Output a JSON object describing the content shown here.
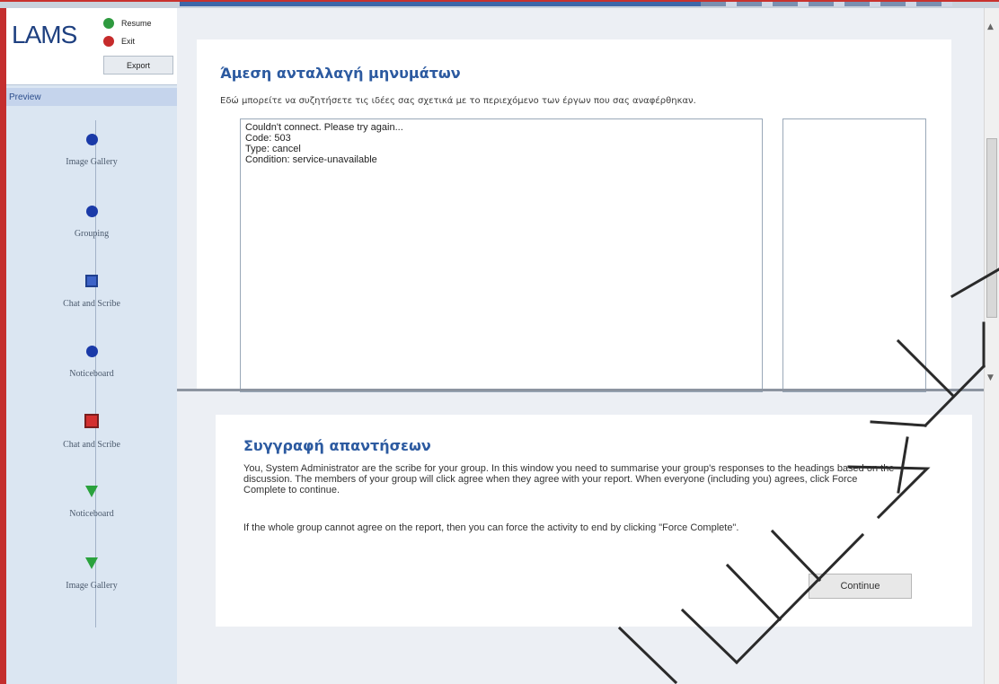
{
  "app": {
    "logo": "LAMS"
  },
  "controls": {
    "resume": "Resume",
    "exit": "Exit",
    "export": "Export"
  },
  "preview": {
    "label": "Preview"
  },
  "activities": [
    {
      "label": "Image Gallery",
      "icon": "completed-circle"
    },
    {
      "label": "Grouping",
      "icon": "completed-circle"
    },
    {
      "label": "Chat and Scribe",
      "icon": "current-square"
    },
    {
      "label": "Noticeboard",
      "icon": "completed-circle"
    },
    {
      "label": "Chat and Scribe",
      "icon": "stop-square"
    },
    {
      "label": "Noticeboard",
      "icon": "future-triangle"
    },
    {
      "label": "Image Gallery",
      "icon": "future-triangle"
    }
  ],
  "chat": {
    "title": "Άμεση ανταλλαγή μηνυμάτων",
    "description": "Εδώ μπορείτε να συζητήσετε τις ιδέες σας σχετικά με το περιεχόμενο των έργων που σας αναφέρθηκαν.",
    "messages": [
      "Couldn't connect. Please try again...",
      "Code: 503",
      "Type: cancel",
      "Condition: service-unavailable"
    ]
  },
  "scribe": {
    "title": "Συγγραφή απαντήσεων",
    "paragraph1": "You, System Administrator are the scribe for your group. In this window you need to summarise your group's responses to the headings based on the discussion. The members of your group will click agree when they agree with your report. When everyone (including you) agrees, click Force Complete to continue.",
    "paragraph2": "If the whole group cannot agree on the report, then you can force the activity to end by clicking \"Force Complete\".",
    "continue_label": "Continue"
  },
  "colors": {
    "accent": "#2c5aa0",
    "frame_red": "#c42e2e",
    "sidebar": "#dbe6f2"
  }
}
